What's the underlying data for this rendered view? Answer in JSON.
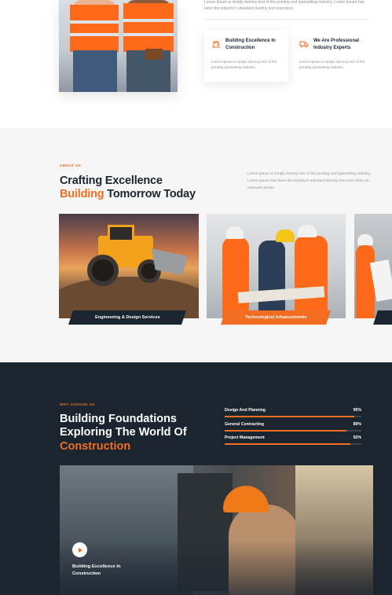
{
  "intro": {
    "text": "Lorem Ipsum is simply dummy text of the printing and typesetting industry. Lorem Ipsum has been the industry's standard dummy text eversince."
  },
  "features": [
    {
      "icon": "crane-icon",
      "title": "Building Excellence In Construction",
      "text": "Lorem Ipsum is simply dummy text of the printing typesetting industry."
    },
    {
      "icon": "truck-icon",
      "title": "We Are Professional Industry Experts",
      "text": "Lorem Ipsum is simply dummy text of the printing typesetting industry."
    }
  ],
  "about": {
    "eyebrow": "ABOUT US",
    "title_line1": "Crafting Excellence",
    "title_accent": "Building",
    "title_rest": "Tomorrow Today",
    "text": "Lorem Ipsum is simply dummy text of the printing and typesetting industry. Lorem Ipsum has been the industry's standard dummy text ever when an unknown printer.",
    "services": [
      {
        "label": "Engineering & Design Services"
      },
      {
        "label": "Technological Advancements"
      }
    ]
  },
  "why": {
    "eyebrow": "WHY CHOOSE US",
    "title_line1": "Building Foundations",
    "title_line2": "Exploring The World Of",
    "title_accent": "Construction",
    "skills": [
      {
        "label": "Design And Planning",
        "percent_label": "95%",
        "value": 95
      },
      {
        "label": "General Contracting",
        "percent_label": "89%",
        "value": 89
      },
      {
        "label": "Project Management",
        "percent_label": "92%",
        "value": 92
      }
    ],
    "video_caption": "Building Excellence In Construction"
  },
  "colors": {
    "accent": "#f26d21",
    "dark": "#1b2530",
    "light_bg": "#f6f6f6"
  }
}
